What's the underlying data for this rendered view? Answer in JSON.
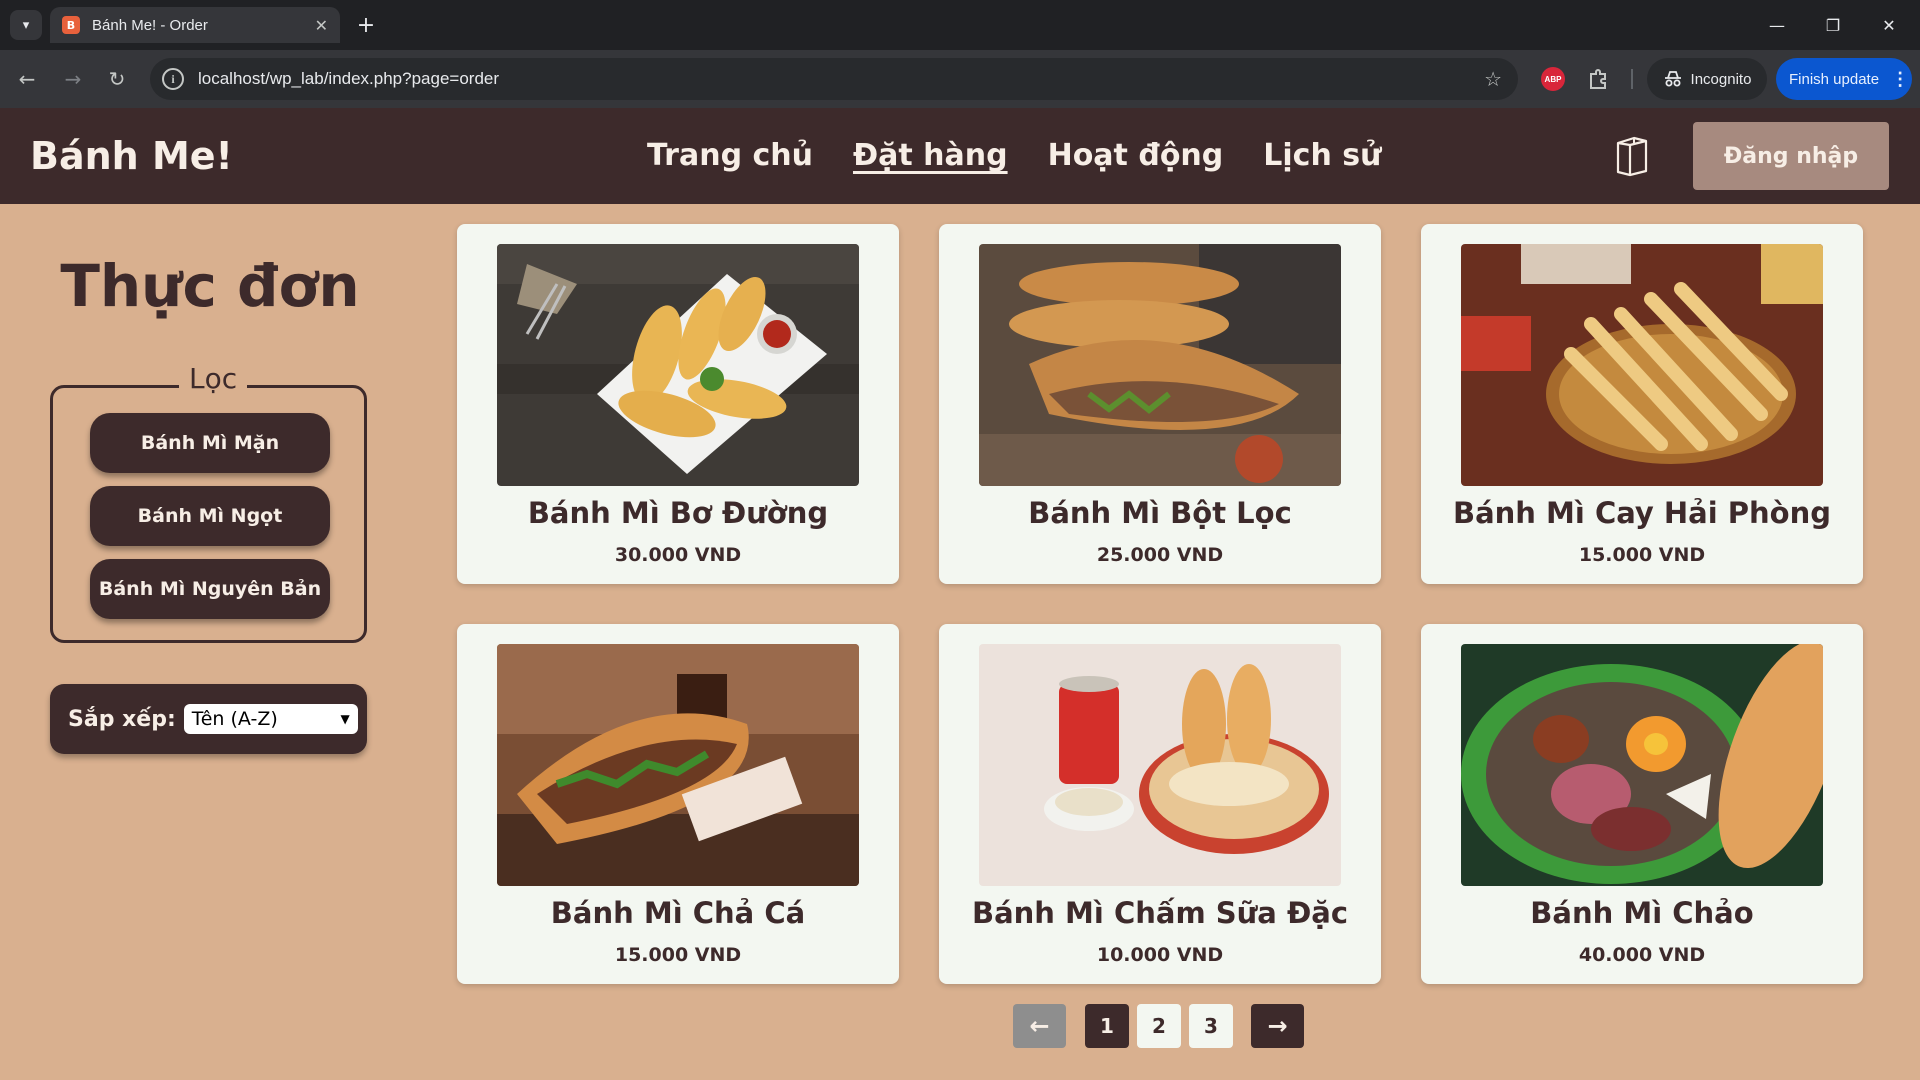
{
  "browser": {
    "tab_title": "Bánh Me! - Order",
    "favicon_letter": "B",
    "url": "localhost/wp_lab/index.php?page=order",
    "profile_label": "Incognito",
    "update_label": "Finish update",
    "abp_label": "ABP"
  },
  "header": {
    "brand": "Bánh Me!",
    "nav": [
      "Trang chủ",
      "Đặt hàng",
      "Hoạt động",
      "Lịch sử"
    ],
    "active_nav": "Đặt hàng",
    "login": "Đăng nhập"
  },
  "sidebar": {
    "title": "Thực đơn",
    "filter_legend": "Lọc",
    "filters": [
      "Bánh Mì Mặn",
      "Bánh Mì Ngọt",
      "Bánh Mì Nguyên Bản"
    ],
    "sort_label": "Sắp xếp:",
    "sort_value": "Tên (A-Z)"
  },
  "products": [
    {
      "name": "Bánh Mì Bơ Đường",
      "price": "30.000 VND",
      "image": "garlic-butter-bread-plate"
    },
    {
      "name": "Bánh Mì Bột Lọc",
      "price": "25.000 VND",
      "image": "stuffed-baguette"
    },
    {
      "name": "Bánh Mì Cay Hải Phòng",
      "price": "15.000 VND",
      "image": "thin-spicy-breadsticks"
    },
    {
      "name": "Bánh Mì Chả Cá",
      "price": "15.000 VND",
      "image": "fish-cake-sandwich"
    },
    {
      "name": "Bánh Mì Chấm Sữa Đặc",
      "price": "10.000 VND",
      "image": "bread-with-condensed-milk"
    },
    {
      "name": "Bánh Mì Chảo",
      "price": "40.000 VND",
      "image": "pan-with-egg-and-meat"
    }
  ],
  "pagination": {
    "prev": "←",
    "next": "→",
    "pages": [
      "1",
      "2",
      "3"
    ],
    "current": "1"
  },
  "colors": {
    "page_bg": "#d9b08f",
    "primary_dark": "#3d2a2b",
    "card_bg": "#f3f7f1",
    "login_bg": "#a78a7f"
  }
}
